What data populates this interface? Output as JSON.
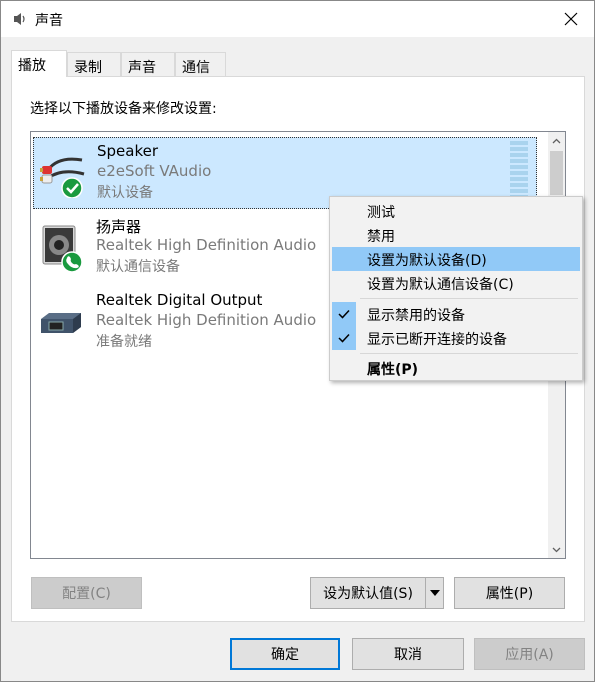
{
  "window": {
    "title": "声音"
  },
  "tabs": [
    {
      "label": "播放"
    },
    {
      "label": "录制"
    },
    {
      "label": "声音"
    },
    {
      "label": "通信"
    }
  ],
  "panel": {
    "instruction": "选择以下播放设备来修改设置:"
  },
  "devices": [
    {
      "name": "Speaker",
      "description": "e2eSoft VAudio",
      "status": "默认设备"
    },
    {
      "name": "扬声器",
      "description": "Realtek High Definition Audio",
      "status": "默认通信设备"
    },
    {
      "name": "Realtek Digital Output",
      "description": "Realtek High Definition Audio",
      "status": "准备就绪"
    }
  ],
  "context_menu": {
    "items": [
      {
        "label": "测试"
      },
      {
        "label": "禁用"
      },
      {
        "label": "设置为默认设备(D)"
      },
      {
        "label": "设置为默认通信设备(C)"
      },
      {
        "label": "显示禁用的设备"
      },
      {
        "label": "显示已断开连接的设备"
      },
      {
        "label": "属性(P)"
      }
    ]
  },
  "panel_buttons": {
    "configure": "配置(C)",
    "set_default": "设为默认值(S)",
    "properties": "属性(P)"
  },
  "dialog_buttons": {
    "ok": "确定",
    "cancel": "取消",
    "apply": "应用(A)"
  },
  "colors": {
    "selection": "#cce8ff",
    "menu_hover": "#91c9f7",
    "accent": "#0078d7",
    "status_green": "#1a9a3f"
  }
}
